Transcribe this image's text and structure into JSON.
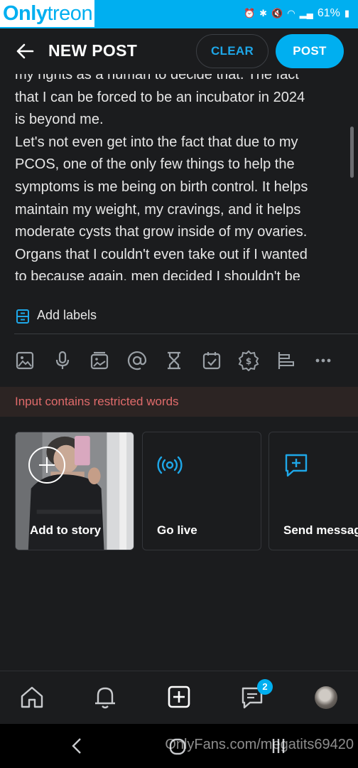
{
  "statusbar": {
    "brand_bold": "Only",
    "brand_rest": "treon",
    "battery": "61%"
  },
  "header": {
    "title": "NEW POST",
    "clear_label": "CLEAR",
    "post_label": "POST"
  },
  "post_text": {
    "lines": [
      "my rights as a human to decide that. The fact",
      "that I can be forced to be an incubator in 2024",
      "is beyond me.",
      "Let's not even get into the fact that due to my",
      "PCOS, one of the only few things to help the",
      "symptoms is me being on birth control. It helps",
      "maintain my weight, my cravings, and it helps",
      "moderate cysts that grow inside of my ovaries.",
      "Organs that I couldn't even take out if I wanted",
      "to because again, men decided I shouldn't be"
    ]
  },
  "labels": {
    "text": "Add labels"
  },
  "toolbar": {
    "icons": [
      "image-icon",
      "microphone-icon",
      "gallery-icon",
      "mention-icon",
      "hourglass-icon",
      "calendar-check-icon",
      "price-tag-icon",
      "poll-icon",
      "more-icon"
    ]
  },
  "warning": {
    "text": "Input contains restricted words"
  },
  "cards": {
    "story": "Add to story",
    "live": "Go live",
    "message": "Send message"
  },
  "bottomnav": {
    "messages_badge": "2"
  },
  "watermark": "OnlyFans.com/megatits69420",
  "colors": {
    "accent": "#00aff0",
    "background": "#1b1c1e",
    "warning_text": "#e06b6b"
  }
}
